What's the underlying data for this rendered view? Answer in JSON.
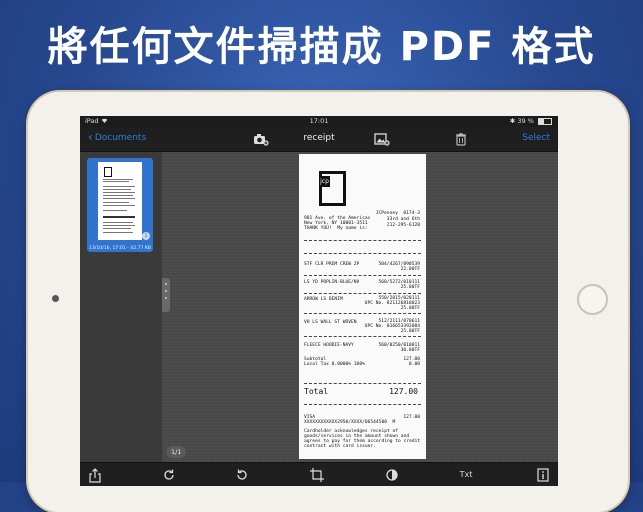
{
  "headline": "將任何文件掃描成 PDF 格式",
  "status": {
    "device": "iPad",
    "wifi": "wifi-icon",
    "time": "17:01",
    "bluetooth": "bluetooth-icon",
    "battery_percent": "39 %",
    "battery_level": 0.39
  },
  "nav": {
    "back_label": "Documents",
    "title": "receipt",
    "select_label": "Select"
  },
  "sidebar": {
    "thumbnail": {
      "meta": "13/10/16, 17:01 - 42.77 KB",
      "badge": "1"
    }
  },
  "content": {
    "page_counter": "1/1"
  },
  "receipt": {
    "header_left": [
      "901 Ave. of the Americas",
      "New York, NY 10001-3511",
      "THANK YOU!  My name is:"
    ],
    "header_right": [
      "JCPenney  0174-3",
      "33rd and 6th",
      "212-295-6120"
    ],
    "items": [
      {
        "name": "STF CLR PREM CREW 2P",
        "code": "504/4267/890539",
        "price": "22.00TF"
      },
      {
        "name": "LS YD POPLIN-BLUE/NV",
        "code": "560/5272/010111",
        "price": "25.00TF"
      },
      {
        "name": "ARROW LS DENIM",
        "code": "550/2015/020111",
        "upc": "UPC No. 821126810023",
        "price": "25.00TF"
      },
      {
        "name": "VH LS WALL ST WOVEN",
        "code": "512/2111/070611",
        "upc": "UPC No. 016653392084",
        "price": "25.00TF"
      },
      {
        "name": "FLEECE HOODIE-NAVY",
        "code": "560/0250/010811",
        "price": "30.00TF"
      }
    ],
    "subtotal_label": "Subtotal",
    "subtotal": "127.00",
    "tax_label": "Local Tax 0.0000% 100%",
    "tax": "0.00",
    "total_label": "Total",
    "total": "127.00",
    "card_label": "VISA",
    "card_amount": "127.00",
    "card_number": "XXXXXXXXXXXX2950/XXXX/06544500  M",
    "footer": [
      "Cardholder acknowledges receipt of",
      "goods/services in the amount shown and",
      "agrees to pay for them according to credit",
      "contract with card issuer."
    ]
  },
  "toolbar": {
    "text_label": "Txt"
  },
  "icons": {
    "camera": "camera-add-icon",
    "image": "image-add-icon",
    "trash": "trash-icon",
    "share": "share-icon",
    "rotate_cw": "rotate-right-icon",
    "rotate_ccw": "rotate-left-icon",
    "crop": "crop-icon",
    "contrast": "contrast-icon",
    "info": "info-icon"
  }
}
